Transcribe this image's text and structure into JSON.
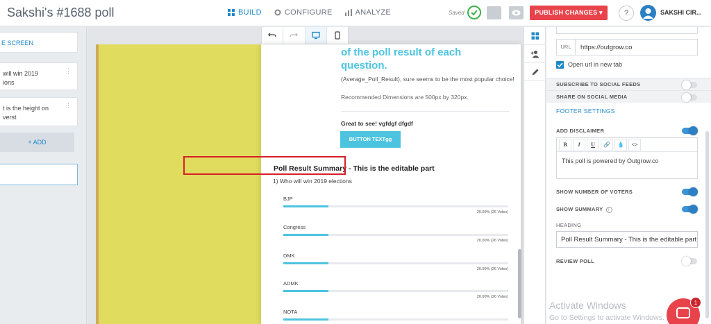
{
  "app": {
    "title": "Sakshi's #1688 poll",
    "saved_label": "Saved"
  },
  "nav": {
    "build": "BUILD",
    "configure": "CONFIGURE",
    "analyze": "ANALYZE"
  },
  "header": {
    "publish_label": "PUBLISH CHANGES",
    "help_label": "?",
    "user_name": "SAKSHI CIR..."
  },
  "left_panel": {
    "link_text": "E SCREEN",
    "items": [
      {
        "text_line1": "will win 2019",
        "text_line2": "ions"
      },
      {
        "text_line1": "t is the height on",
        "text_line2": "verst"
      }
    ],
    "add_label": "+ ADD"
  },
  "preview": {
    "result_heading": "of the poll result of each question.",
    "description": "(Average_Poll_Result), sure seems to be the most popular choice!",
    "recommended": "Recommended Dimensions are 500px by 320px.",
    "great": "Great to see! vgfdgf dfgdf",
    "button_text": "BUTTON TEXTgg",
    "summary_heading": "Poll Result Summary - This is the editable part",
    "question": "1)   Who will win 2019 elections",
    "options": [
      {
        "label": "BJP",
        "pct": "20.00% (26 Votes)",
        "fill": 0.2
      },
      {
        "label": "Congress",
        "pct": "20.00% (26 Votes)",
        "fill": 0.2
      },
      {
        "label": "DMK",
        "pct": "20.00% (26 Votes)",
        "fill": 0.2
      },
      {
        "label": "ADMK",
        "pct": "20.00% (26 Votes)",
        "fill": 0.2
      },
      {
        "label": "NOTA",
        "pct": "",
        "fill": 0.2
      }
    ]
  },
  "settings": {
    "url_label": "URL",
    "url_value": "https://outgrow.co",
    "open_new_tab": "Open url in new tab",
    "subscribe": "SUBSCRIBE TO SOCIAL FEEDS",
    "share": "SHARE ON SOCIAL MEDIA",
    "footer_settings": "FOOTER SETTINGS",
    "add_disclaimer": "ADD DISCLAIMER",
    "disclaimer_text": "This poll is powered by Outgrow.co",
    "show_voters": "SHOW NUMBER OF VOTERS",
    "show_summary": "SHOW SUMMARY",
    "heading_label": "HEADING",
    "heading_value": "Poll Result Summary - This is the editable part",
    "review_poll": "REVIEW POLL",
    "editor_buttons": [
      "B",
      "I",
      "U",
      "🔗",
      "💧",
      "<>"
    ]
  },
  "watermark": {
    "line1": "Activate Windows",
    "line2": "Go to Settings to activate Windows."
  },
  "chat_badge": "1",
  "colors": {
    "accent": "#1e88c8",
    "publish": "#e8434b",
    "brand_cyan": "#4cc4df",
    "highlight": "#d62027",
    "canvas_bg": "#e0dc5e"
  }
}
